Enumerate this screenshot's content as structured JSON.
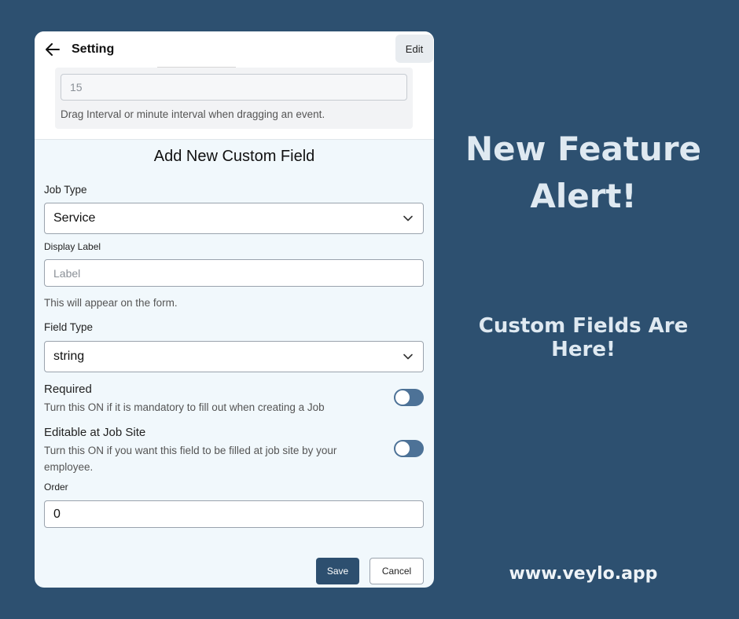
{
  "header": {
    "title": "Setting",
    "edit_label": "Edit"
  },
  "drag_interval": {
    "value": "15",
    "help": "Drag Interval or minute interval when dragging an event."
  },
  "form": {
    "title": "Add New Custom Field",
    "job_type": {
      "label": "Job Type",
      "value": "Service"
    },
    "display_label": {
      "label": "Display Label",
      "placeholder": "Label",
      "hint": "This will appear on the form."
    },
    "field_type": {
      "label": "Field Type",
      "value": "string"
    },
    "required": {
      "title": "Required",
      "desc": "Turn this ON if it is mandatory to fill out when creating a Job",
      "on": false
    },
    "editable_at_site": {
      "title": "Editable at Job Site",
      "desc": "Turn this ON if you want this field to be filled at job site by your employee.",
      "on": false
    },
    "order": {
      "label": "Order",
      "value": "0"
    },
    "save_label": "Save",
    "cancel_label": "Cancel"
  },
  "promo": {
    "headline_line1": "New Feature",
    "headline_line2": "Alert!",
    "subhead": "Custom Fields Are Here!",
    "url": "www.veylo.app"
  },
  "colors": {
    "background": "#2d5070",
    "card": "#f1f8fc",
    "primary_button": "#2d4f6f",
    "toggle_track": "#4d7297"
  },
  "icons": {
    "back": "arrow-left-icon",
    "dropdown": "chevron-down-icon"
  }
}
